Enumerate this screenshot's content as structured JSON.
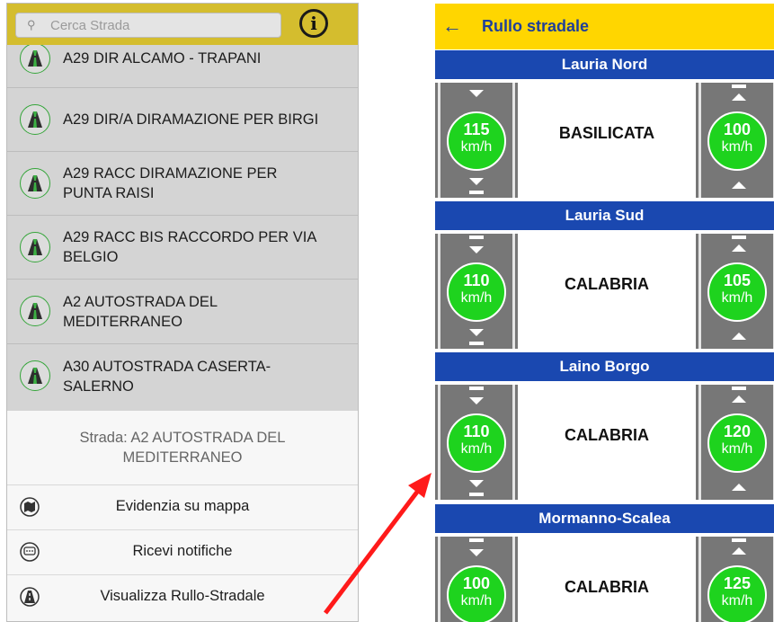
{
  "left": {
    "search": {
      "placeholder": "Cerca Strada",
      "icon": "search-icon"
    },
    "info_icon": "i",
    "roads": [
      {
        "line1": "A29 DIR ALCAMO - TRAPANI",
        "line2": ""
      },
      {
        "line1": "A29 DIR/A DIRAMAZIONE PER BIRGI",
        "line2": ""
      },
      {
        "line1": "A29 RACC DIRAMAZIONE PER",
        "line2": "PUNTA RAISI"
      },
      {
        "line1": "A29 RACC BIS RACCORDO PER VIA",
        "line2": "BELGIO"
      },
      {
        "line1": "A2 AUTOSTRADA DEL",
        "line2": "MEDITERRANEO"
      },
      {
        "line1": "A30 AUTOSTRADA CASERTA-",
        "line2": "SALERNO"
      }
    ],
    "sheet": {
      "title_line1": "Strada: A2 AUTOSTRADA DEL",
      "title_line2": "MEDITERRANEO",
      "actions": [
        {
          "label": "Evidenzia su mappa",
          "icon": "map-icon"
        },
        {
          "label": "Ricevi notifiche",
          "icon": "chat-icon"
        },
        {
          "label": "Visualizza Rullo-Stradale",
          "icon": "road-icon"
        }
      ]
    }
  },
  "right": {
    "title": "Rullo stradale",
    "back_icon": "←",
    "stations": [
      {
        "name": "Lauria Nord",
        "region": "BASILICATA",
        "speed_left": "115",
        "speed_right": "100",
        "unit": "km/h"
      },
      {
        "name": "Lauria Sud",
        "region": "CALABRIA",
        "speed_left": "110",
        "speed_right": "105",
        "unit": "km/h"
      },
      {
        "name": "Laino Borgo",
        "region": "CALABRIA",
        "speed_left": "110",
        "speed_right": "120",
        "unit": "km/h"
      },
      {
        "name": "Mormanno-Scalea",
        "region": "CALABRIA",
        "speed_left": "100",
        "speed_right": "125",
        "unit": "km/h"
      }
    ]
  },
  "colors": {
    "accent_yellow": "#ffd600",
    "header_blue": "#1a48b0",
    "speed_green": "#1ed31e",
    "arrow_red": "#ff0000"
  }
}
